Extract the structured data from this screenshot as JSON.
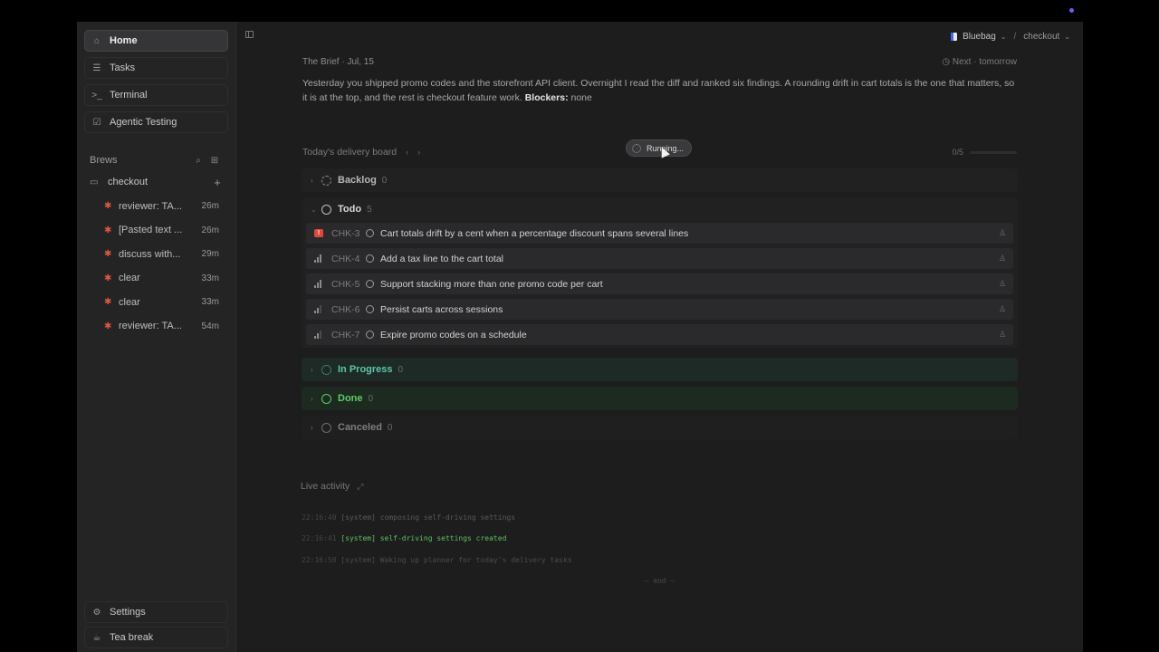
{
  "sidebar": {
    "nav": [
      {
        "label": "Home",
        "icon": "home-icon"
      },
      {
        "label": "Tasks",
        "icon": "tasks-icon"
      },
      {
        "label": "Terminal",
        "icon": "terminal-icon"
      },
      {
        "label": "Agentic Testing",
        "icon": "checkbox-icon"
      }
    ],
    "brews_label": "Brews",
    "folder": "checkout",
    "brews": [
      {
        "name": "reviewer: TA...",
        "age": "26m"
      },
      {
        "name": "[Pasted text ...",
        "age": "26m"
      },
      {
        "name": "discuss with...",
        "age": "29m"
      },
      {
        "name": "clear",
        "age": "33m"
      },
      {
        "name": "clear",
        "age": "33m"
      },
      {
        "name": "reviewer: TA...",
        "age": "54m"
      }
    ],
    "settings": "Settings",
    "tea_break": "Tea break"
  },
  "header": {
    "workspace": "Bluebag",
    "project": "checkout"
  },
  "brief": {
    "title": "The Brief · Jul, 15",
    "next": "Next · tomorrow",
    "text": "Yesterday you shipped promo codes and the storefront API client. Overnight I read the diff and ranked six findings. A rounding drift in cart totals is the one that matters, so it is at the top, and the rest is checkout feature work.",
    "blockers_label": "Blockers:",
    "blockers_value": "none"
  },
  "board": {
    "title": "Today's delivery board",
    "running": "Running...",
    "progress": "0/5",
    "progress_fraction": 0,
    "groups": {
      "backlog": {
        "label": "Backlog",
        "count": "0"
      },
      "todo": {
        "label": "Todo",
        "count": "5"
      },
      "in_progress": {
        "label": "In Progress",
        "count": "0"
      },
      "done": {
        "label": "Done",
        "count": "0"
      },
      "canceled": {
        "label": "Canceled",
        "count": "0"
      }
    },
    "tasks": [
      {
        "id": "CHK-3",
        "title": "Cart totals drift by a cent when a percentage discount spans several lines",
        "priority": "urgent"
      },
      {
        "id": "CHK-4",
        "title": "Add a tax line to the cart total",
        "priority": "high"
      },
      {
        "id": "CHK-5",
        "title": "Support stacking more than one promo code per cart",
        "priority": "high"
      },
      {
        "id": "CHK-6",
        "title": "Persist carts across sessions",
        "priority": "medium"
      },
      {
        "id": "CHK-7",
        "title": "Expire promo codes on a schedule",
        "priority": "medium"
      }
    ]
  },
  "live": {
    "title": "Live activity",
    "logs": [
      {
        "time": "22:16:40",
        "text": "[system] composing self-driving settings",
        "status": "muted"
      },
      {
        "time": "22:16:41",
        "text": "[system] self-driving settings created",
        "status": "ok"
      },
      {
        "time": "22:16:50",
        "text": "[system] Waking up planner for today's delivery tasks",
        "status": "muted"
      }
    ],
    "end": "— end —"
  },
  "colors": {
    "accent": "#6d5cf0",
    "urgent": "#e0483c",
    "in_progress": "#5ec4a8",
    "done": "#5ccc66",
    "brew_star": "#e0573f"
  }
}
